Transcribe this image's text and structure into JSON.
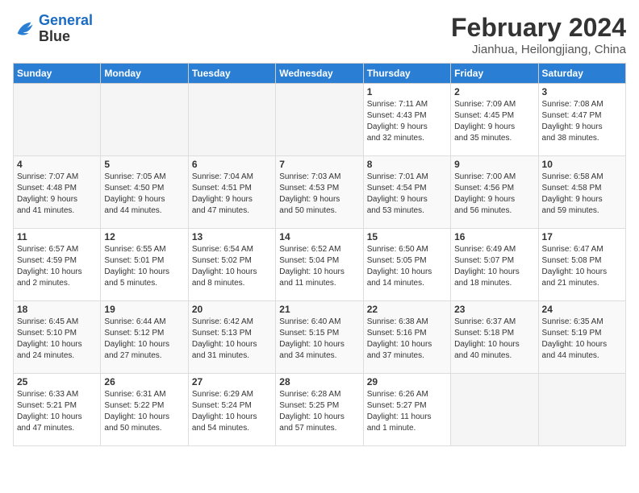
{
  "header": {
    "logo_line1": "General",
    "logo_line2": "Blue",
    "month_title": "February 2024",
    "location": "Jianhua, Heilongjiang, China"
  },
  "weekdays": [
    "Sunday",
    "Monday",
    "Tuesday",
    "Wednesday",
    "Thursday",
    "Friday",
    "Saturday"
  ],
  "weeks": [
    [
      {
        "day": "",
        "info": ""
      },
      {
        "day": "",
        "info": ""
      },
      {
        "day": "",
        "info": ""
      },
      {
        "day": "",
        "info": ""
      },
      {
        "day": "1",
        "info": "Sunrise: 7:11 AM\nSunset: 4:43 PM\nDaylight: 9 hours\nand 32 minutes."
      },
      {
        "day": "2",
        "info": "Sunrise: 7:09 AM\nSunset: 4:45 PM\nDaylight: 9 hours\nand 35 minutes."
      },
      {
        "day": "3",
        "info": "Sunrise: 7:08 AM\nSunset: 4:47 PM\nDaylight: 9 hours\nand 38 minutes."
      }
    ],
    [
      {
        "day": "4",
        "info": "Sunrise: 7:07 AM\nSunset: 4:48 PM\nDaylight: 9 hours\nand 41 minutes."
      },
      {
        "day": "5",
        "info": "Sunrise: 7:05 AM\nSunset: 4:50 PM\nDaylight: 9 hours\nand 44 minutes."
      },
      {
        "day": "6",
        "info": "Sunrise: 7:04 AM\nSunset: 4:51 PM\nDaylight: 9 hours\nand 47 minutes."
      },
      {
        "day": "7",
        "info": "Sunrise: 7:03 AM\nSunset: 4:53 PM\nDaylight: 9 hours\nand 50 minutes."
      },
      {
        "day": "8",
        "info": "Sunrise: 7:01 AM\nSunset: 4:54 PM\nDaylight: 9 hours\nand 53 minutes."
      },
      {
        "day": "9",
        "info": "Sunrise: 7:00 AM\nSunset: 4:56 PM\nDaylight: 9 hours\nand 56 minutes."
      },
      {
        "day": "10",
        "info": "Sunrise: 6:58 AM\nSunset: 4:58 PM\nDaylight: 9 hours\nand 59 minutes."
      }
    ],
    [
      {
        "day": "11",
        "info": "Sunrise: 6:57 AM\nSunset: 4:59 PM\nDaylight: 10 hours\nand 2 minutes."
      },
      {
        "day": "12",
        "info": "Sunrise: 6:55 AM\nSunset: 5:01 PM\nDaylight: 10 hours\nand 5 minutes."
      },
      {
        "day": "13",
        "info": "Sunrise: 6:54 AM\nSunset: 5:02 PM\nDaylight: 10 hours\nand 8 minutes."
      },
      {
        "day": "14",
        "info": "Sunrise: 6:52 AM\nSunset: 5:04 PM\nDaylight: 10 hours\nand 11 minutes."
      },
      {
        "day": "15",
        "info": "Sunrise: 6:50 AM\nSunset: 5:05 PM\nDaylight: 10 hours\nand 14 minutes."
      },
      {
        "day": "16",
        "info": "Sunrise: 6:49 AM\nSunset: 5:07 PM\nDaylight: 10 hours\nand 18 minutes."
      },
      {
        "day": "17",
        "info": "Sunrise: 6:47 AM\nSunset: 5:08 PM\nDaylight: 10 hours\nand 21 minutes."
      }
    ],
    [
      {
        "day": "18",
        "info": "Sunrise: 6:45 AM\nSunset: 5:10 PM\nDaylight: 10 hours\nand 24 minutes."
      },
      {
        "day": "19",
        "info": "Sunrise: 6:44 AM\nSunset: 5:12 PM\nDaylight: 10 hours\nand 27 minutes."
      },
      {
        "day": "20",
        "info": "Sunrise: 6:42 AM\nSunset: 5:13 PM\nDaylight: 10 hours\nand 31 minutes."
      },
      {
        "day": "21",
        "info": "Sunrise: 6:40 AM\nSunset: 5:15 PM\nDaylight: 10 hours\nand 34 minutes."
      },
      {
        "day": "22",
        "info": "Sunrise: 6:38 AM\nSunset: 5:16 PM\nDaylight: 10 hours\nand 37 minutes."
      },
      {
        "day": "23",
        "info": "Sunrise: 6:37 AM\nSunset: 5:18 PM\nDaylight: 10 hours\nand 40 minutes."
      },
      {
        "day": "24",
        "info": "Sunrise: 6:35 AM\nSunset: 5:19 PM\nDaylight: 10 hours\nand 44 minutes."
      }
    ],
    [
      {
        "day": "25",
        "info": "Sunrise: 6:33 AM\nSunset: 5:21 PM\nDaylight: 10 hours\nand 47 minutes."
      },
      {
        "day": "26",
        "info": "Sunrise: 6:31 AM\nSunset: 5:22 PM\nDaylight: 10 hours\nand 50 minutes."
      },
      {
        "day": "27",
        "info": "Sunrise: 6:29 AM\nSunset: 5:24 PM\nDaylight: 10 hours\nand 54 minutes."
      },
      {
        "day": "28",
        "info": "Sunrise: 6:28 AM\nSunset: 5:25 PM\nDaylight: 10 hours\nand 57 minutes."
      },
      {
        "day": "29",
        "info": "Sunrise: 6:26 AM\nSunset: 5:27 PM\nDaylight: 11 hours\nand 1 minute."
      },
      {
        "day": "",
        "info": ""
      },
      {
        "day": "",
        "info": ""
      }
    ]
  ]
}
